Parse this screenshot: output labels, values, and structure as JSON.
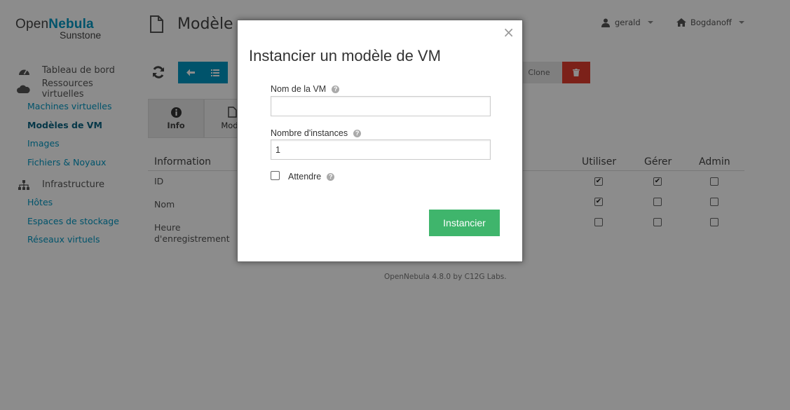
{
  "app": {
    "logo_main": "Open",
    "logo_accent": "Nebula",
    "logo_sub": "Sunstone",
    "page_title": "Modèle",
    "user": "gerald",
    "group": "Bogdanoff"
  },
  "sidebar": {
    "sections": [
      {
        "label": "Tableau de bord",
        "icon": "dashboard-icon"
      },
      {
        "label": "Ressources virtuelles",
        "icon": "cloud-icon"
      },
      {
        "label": "Infrastructure",
        "icon": "sitemap-icon"
      }
    ],
    "virtual_items": [
      "Machines virtuelles",
      "Modèles de VM",
      "Images",
      "Fichiers & Noyaux"
    ],
    "infra_items": [
      "Hôtes",
      "Espaces de stockage",
      "Réseaux virtuels"
    ],
    "active": "Modèles de VM"
  },
  "toolbar": {
    "clone_label": "Clone"
  },
  "tabs": [
    {
      "label": "Info",
      "icon": "info-circle-icon"
    },
    {
      "label": "Modè",
      "icon": "file-icon"
    }
  ],
  "info": {
    "heading": "Information",
    "rows": [
      "ID",
      "Nom",
      "Heure d'enregistrement"
    ]
  },
  "permissions": {
    "columns": [
      "Utiliser",
      "Gérer",
      "Admin"
    ],
    "rows": [
      [
        true,
        true,
        false
      ],
      [
        true,
        false,
        false
      ],
      [
        false,
        false,
        false
      ]
    ]
  },
  "footer": "OpenNebula 4.8.0 by C12G Labs.",
  "modal": {
    "title": "Instancier un modèle de VM",
    "close": "×",
    "vm_name_label": "Nom de la VM",
    "vm_name_value": "",
    "instances_label": "Nombre d'instances",
    "instances_value": "1",
    "wait_label": "Attendre",
    "wait_checked": false,
    "submit_label": "Instancier",
    "help_glyph": "?"
  }
}
